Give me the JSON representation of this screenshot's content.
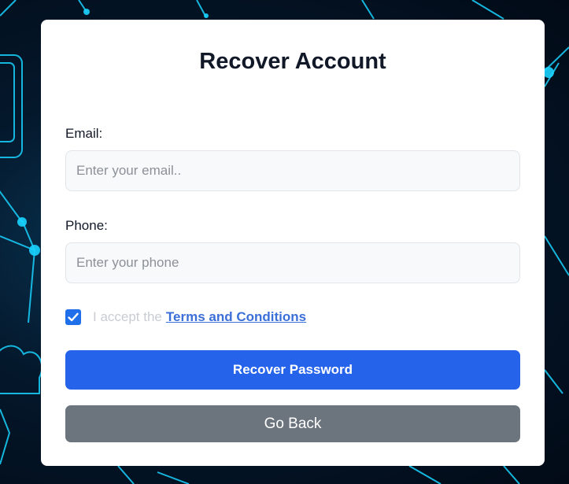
{
  "form": {
    "title": "Recover Account",
    "email_label": "Email:",
    "email_placeholder": "Enter your email..",
    "email_value": "",
    "phone_label": "Phone:",
    "phone_placeholder": "Enter your phone",
    "phone_value": "",
    "terms_checked": true,
    "terms_prefix": "I accept the",
    "terms_link": "Terms and Conditions",
    "recover_button": "Recover Password",
    "back_button": "Go Back"
  },
  "icons": {
    "checkbox": "checkmark-icon"
  },
  "colors": {
    "primary": "#2563eb",
    "secondary": "#6c757d",
    "link": "#3b6fd8",
    "checkbox": "#1f6feb",
    "card": "#ffffff"
  }
}
